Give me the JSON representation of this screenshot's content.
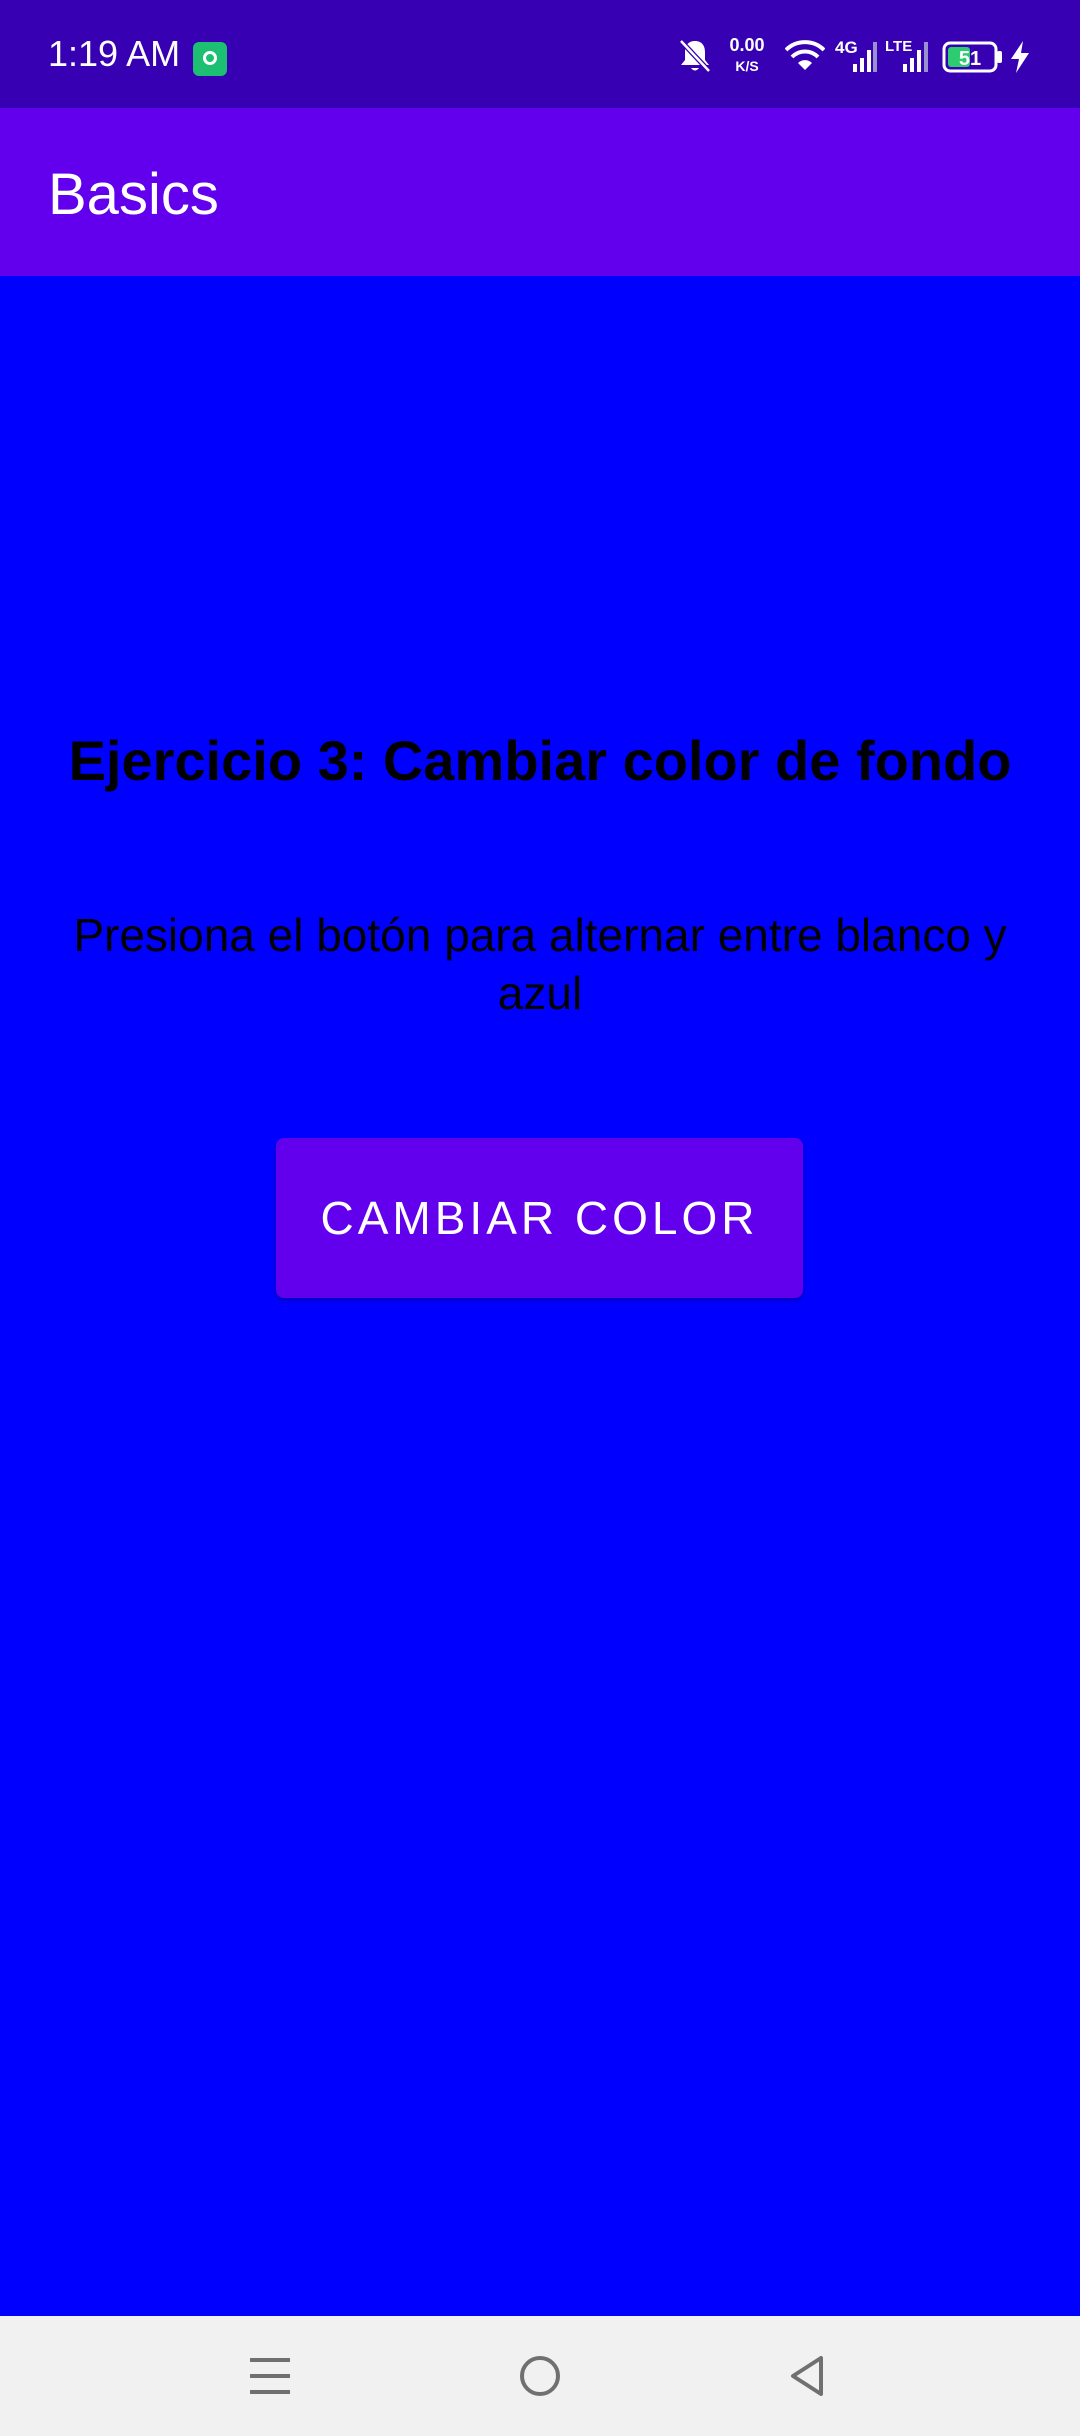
{
  "status_bar": {
    "time": "1:19 AM",
    "net_speed_value": "0.00",
    "net_speed_unit": "K/S",
    "network_4g": "4G",
    "network_lte": "LTE",
    "battery_level": "51",
    "icons": [
      "app-notification-icon",
      "bell-muted-icon",
      "wifi-icon",
      "signal-4g-icon",
      "signal-lte-icon",
      "battery-icon",
      "charging-icon"
    ]
  },
  "app_bar": {
    "title": "Basics"
  },
  "main": {
    "heading": "Ejercicio 3: Cambiar color de fondo",
    "description": "Presiona el botón para alternar entre blanco y azul",
    "button_label": "CAMBIAR COLOR"
  },
  "nav_bar": {
    "icons": [
      "menu-icon",
      "home-icon",
      "back-icon"
    ]
  },
  "colors": {
    "status_bar": "#3700B3",
    "app_bar": "#6200EE",
    "background": "#0000FF",
    "button": "#6200EE",
    "nav_bar": "#F1F1F1"
  }
}
